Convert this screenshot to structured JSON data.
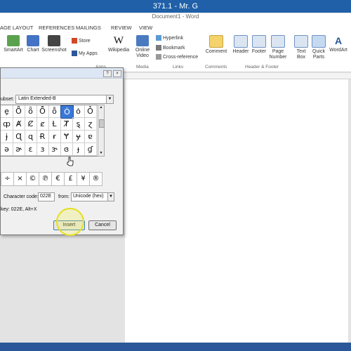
{
  "window": {
    "title": "371.1 - Mr. G",
    "document_title": "Document1 - Word"
  },
  "tabs": [
    "AGE LAYOUT",
    "REFERENCES",
    "MAILINGS",
    "REVIEW",
    "VIEW"
  ],
  "ribbon": {
    "smartart": "SmartArt",
    "chart": "Chart",
    "screenshot": "Screenshot",
    "store": "Store",
    "my_apps": "My Apps",
    "wikipedia": "Wikipedia",
    "online_video": [
      "Online",
      "Video"
    ],
    "hyperlink": "Hyperlink",
    "bookmark": "Bookmark",
    "cross_reference": "Cross-reference",
    "comment": "Comment",
    "header": "Header",
    "footer": "Footer",
    "page_number": [
      "Page",
      "Number"
    ],
    "text_box": [
      "Text",
      "Box"
    ],
    "quick_parts": [
      "Quick",
      "Parts"
    ],
    "wordart": "WordArt",
    "groups": {
      "apps": "Apps",
      "media": "Media",
      "links": "Links",
      "comments": "Comments",
      "header_footer": "Header & Footer"
    }
  },
  "dialog": {
    "subset_label": "ubset:",
    "subset_value": "Latin Extended-B",
    "grid": [
      [
        "ȩ",
        "Ȫ",
        "ȫ",
        "Ȭ",
        "ȭ",
        "Ȯ",
        "ȯ",
        "Ȱ"
      ],
      [
        "ȹ",
        "Ⱥ",
        "Ȼ",
        "ȼ",
        "Ƚ",
        "Ⱦ",
        "ȿ",
        "ɀ"
      ],
      [
        "ɉ",
        "Ɋ",
        "ɋ",
        "Ɍ",
        "ɍ",
        "Ɏ",
        "ɏ",
        "ɐ"
      ],
      [
        "ə",
        "ɚ",
        "ɛ",
        "ɜ",
        "ɝ",
        "ɞ",
        "ɟ",
        "ɠ"
      ]
    ],
    "recent": [
      "÷",
      "×",
      "©",
      "℗",
      "€",
      "£",
      "¥",
      "®"
    ],
    "character_code_label": "Character code:",
    "character_code_value": "022E",
    "from_label": "from:",
    "from_value": "Unicode (hex)",
    "shortcut": "key: 022E, Alt+X",
    "insert": "Insert",
    "cancel": "Cancel",
    "help_btn": "?",
    "close_btn": "×"
  },
  "colors": {
    "title_bar": "#1f60a8",
    "status_bar": "#2b579a",
    "selected_cell": "#3a78d6"
  }
}
